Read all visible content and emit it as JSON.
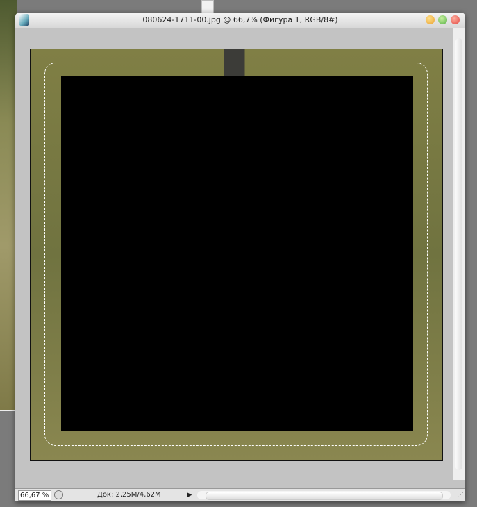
{
  "window": {
    "title": "080624-1711-00.jpg @ 66,7% (Фигура 1, RGB/8#)"
  },
  "status": {
    "zoom": "66,67 %",
    "doc_info": "Док: 2,25M/4,62M",
    "menu_arrow": "▶"
  },
  "colors": {
    "close": "#e0443e",
    "minimize": "#e8a030",
    "maximize": "#55b044",
    "fill": "#000000"
  }
}
